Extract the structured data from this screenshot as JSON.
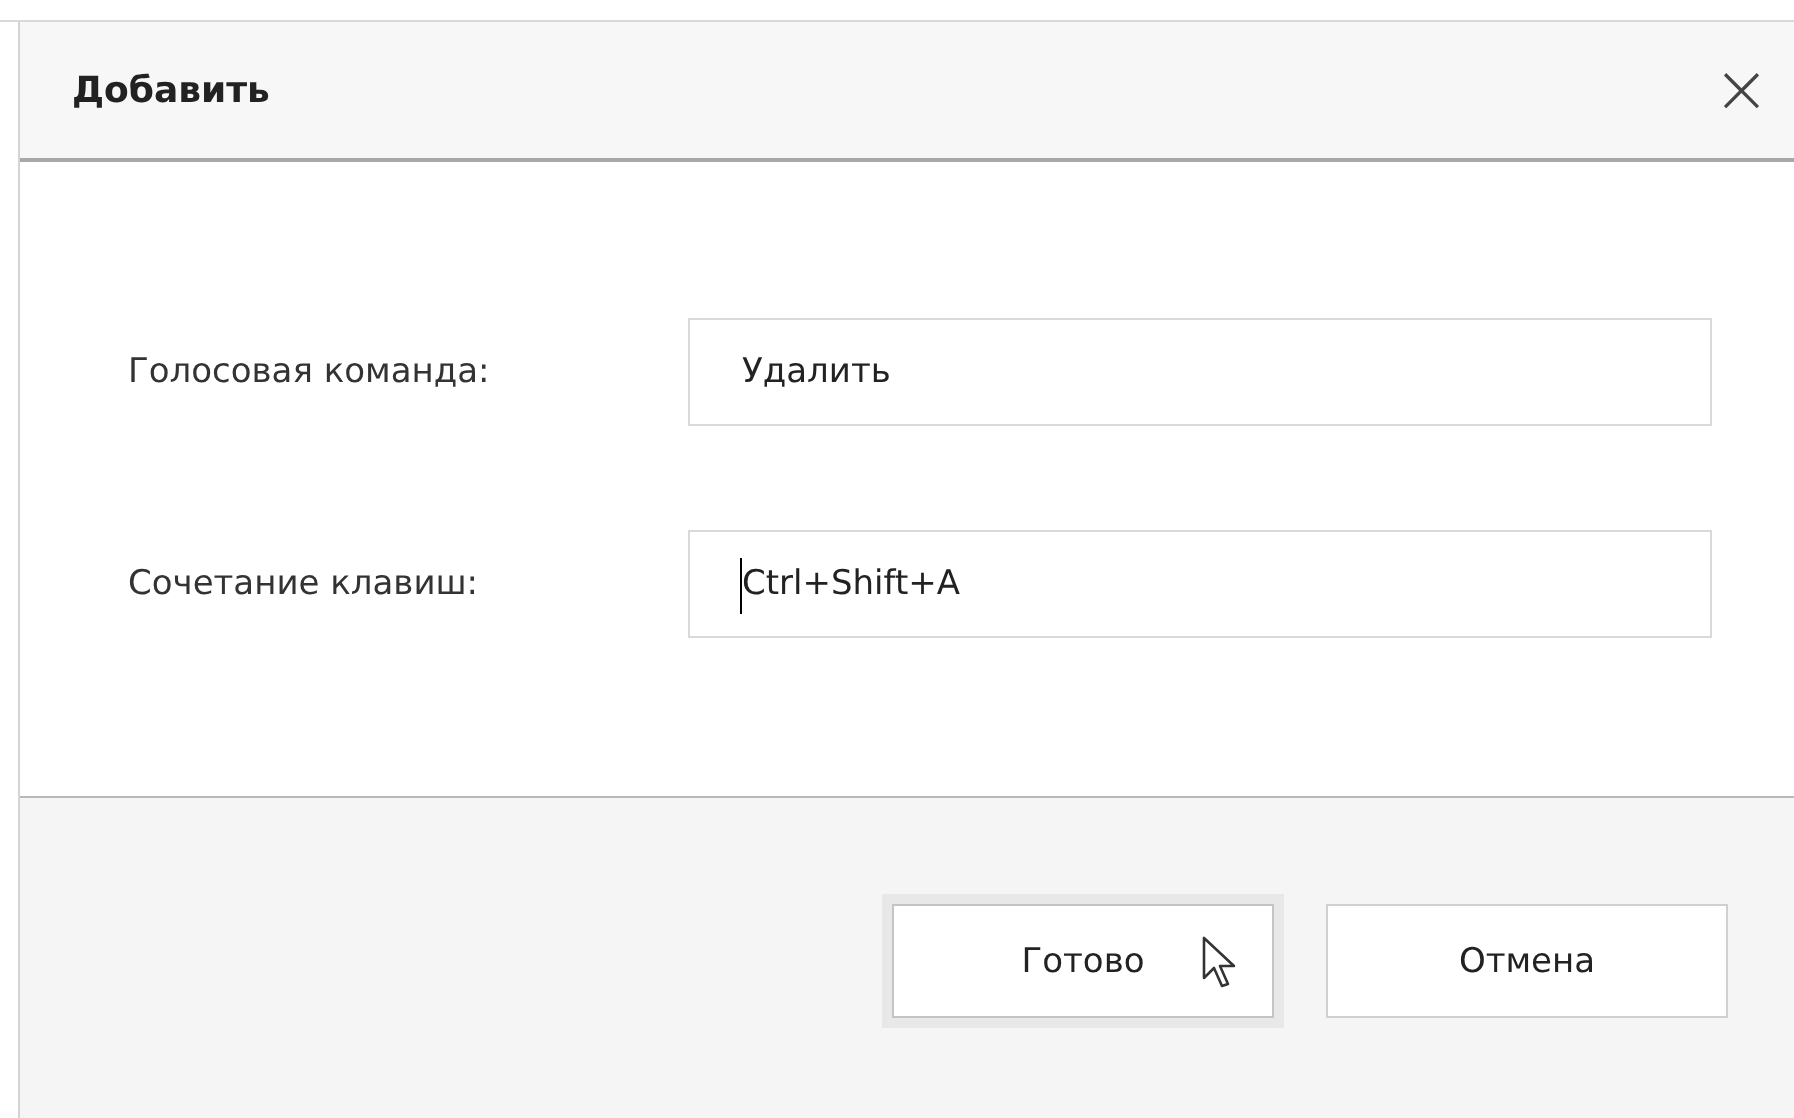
{
  "dialog": {
    "title": "Добавить",
    "close": "×"
  },
  "fields": [
    {
      "label": "Голосовая команда:",
      "value": "Удалить",
      "focused": false
    },
    {
      "label": "Сочетание клавиш:",
      "value": "Ctrl+Shift+A",
      "focused": true
    }
  ],
  "buttons": [
    {
      "label": "Готово",
      "focused": true,
      "hovered": true
    },
    {
      "label": "Отмена",
      "focused": false,
      "hovered": false
    }
  ]
}
